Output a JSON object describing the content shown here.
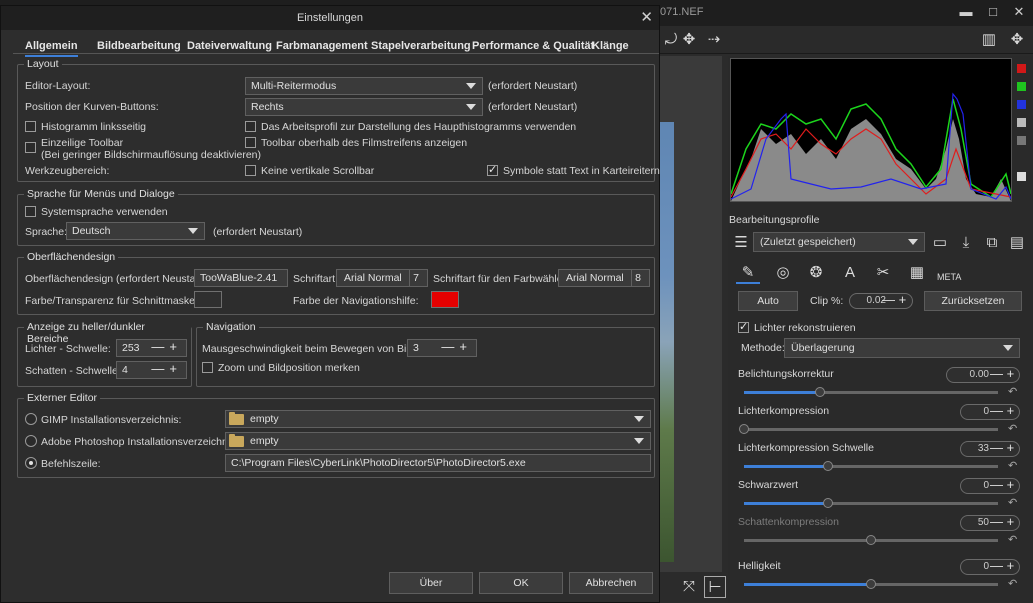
{
  "app": {
    "title_fragment": "071.NEF",
    "minimize": "▬",
    "maximize": "□",
    "close": "✕"
  },
  "right_panel": {
    "profiles_title": "Bearbeitungsprofile",
    "profile_selected": "(Zuletzt gespeichert)",
    "auto": "Auto",
    "clip_label": "Clip %:",
    "clip_value": "0.02",
    "reset": "Zurücksetzen",
    "recover_highlights": "Lichter rekonstruieren",
    "method_label": "Methode:",
    "method_value": "Überlagerung",
    "sliders": [
      {
        "label": "Belichtungskorrektur",
        "value": "0.00",
        "fill": 0.3,
        "dim": false
      },
      {
        "label": "Lichterkompression",
        "value": "0",
        "fill": 0.0,
        "dim": false
      },
      {
        "label": "Lichterkompression Schwelle",
        "value": "33",
        "fill": 0.33,
        "dim": false
      },
      {
        "label": "Schwarzwert",
        "value": "0",
        "fill": 0.33,
        "dim": false
      },
      {
        "label": "Schattenkompression",
        "value": "50",
        "fill": 0.5,
        "dim": true
      },
      {
        "label": "Helligkeit",
        "value": "0",
        "fill": 0.5,
        "dim": false
      }
    ],
    "meta_label": "META",
    "accent": "#3d7fd8"
  },
  "dialog": {
    "title": "Einstellungen",
    "close": "✕",
    "tabs": [
      "Allgemein",
      "Bildbearbeitung",
      "Dateiverwaltung",
      "Farbmanagement",
      "Stapelverarbeitung",
      "Performance & Qualität",
      "Klänge"
    ],
    "layout": {
      "legend": "Layout",
      "editor_layout_label": "Editor-Layout:",
      "editor_layout_value": "Multi-Reitermodus",
      "restart_note": "(erfordert Neustart)",
      "curve_buttons_label": "Position der Kurven-Buttons:",
      "curve_buttons_value": "Rechts",
      "hist_left": "Histogramm linksseitig",
      "single_toolbar": "Einzeilige Toolbar",
      "single_toolbar_note": "(Bei geringer Bildschirmauflösung deaktivieren)",
      "tool_area": "Werkzeugbereich:",
      "working_profile": "Das Arbeitsprofil zur Darstellung des Haupthistogramms verwenden",
      "toolbar_above": "Toolbar oberhalb des Filmstreifens anzeigen",
      "no_vscroll": "Keine vertikale Scrollbar",
      "symbols_tabs": "Symbole statt Text in Karteireitern"
    },
    "language": {
      "legend": "Sprache für Menüs und Dialoge",
      "system_lang": "Systemsprache verwenden",
      "lang_label": "Sprache:",
      "lang_value": "Deutsch",
      "restart_note": "(erfordert Neustart)"
    },
    "surface": {
      "legend": "Oberflächendesign",
      "theme_label": "Oberflächendesign (erfordert Neustart):",
      "theme_value": "TooWaBlue-2.41",
      "font_label": "Schriftart",
      "font_name": "Arial Normal",
      "font_size": "7",
      "picker_font_label": "Schriftart für den Farbwähler:",
      "picker_font_name": "Arial Normal",
      "picker_font_size": "8",
      "crop_mask_label": "Farbe/Transparenz für Schnittmaske:",
      "crop_mask_color": "#2f2f2f",
      "nav_color_label": "Farbe der Navigationshilfe:",
      "nav_color": "#e60000"
    },
    "zones": {
      "legend": "Anzeige zu heller/dunkler Bereiche",
      "highlights_label": "Lichter - Schwelle:",
      "highlights_value": "253",
      "shadows_label": "Schatten - Schwelle:",
      "shadows_value": "4"
    },
    "navigation": {
      "legend": "Navigation",
      "pan_speed_label": "Mausgeschwindigkeit beim Bewegen von Bildern:",
      "pan_speed_value": "3",
      "remember_zoom": "Zoom und Bildposition merken"
    },
    "external": {
      "legend": "Externer Editor",
      "gimp_label": "GIMP Installationsverzeichnis:",
      "gimp_value": "empty",
      "photoshop_label": "Adobe Photoshop Installationsverzeichnis:",
      "photoshop_value": "empty",
      "cmd_label": "Befehlszeile:",
      "cmd_value": "C:\\Program Files\\CyberLink\\PhotoDirector5\\PhotoDirector5.exe"
    },
    "buttons": {
      "about": "Über",
      "ok": "OK",
      "cancel": "Abbrechen"
    }
  }
}
